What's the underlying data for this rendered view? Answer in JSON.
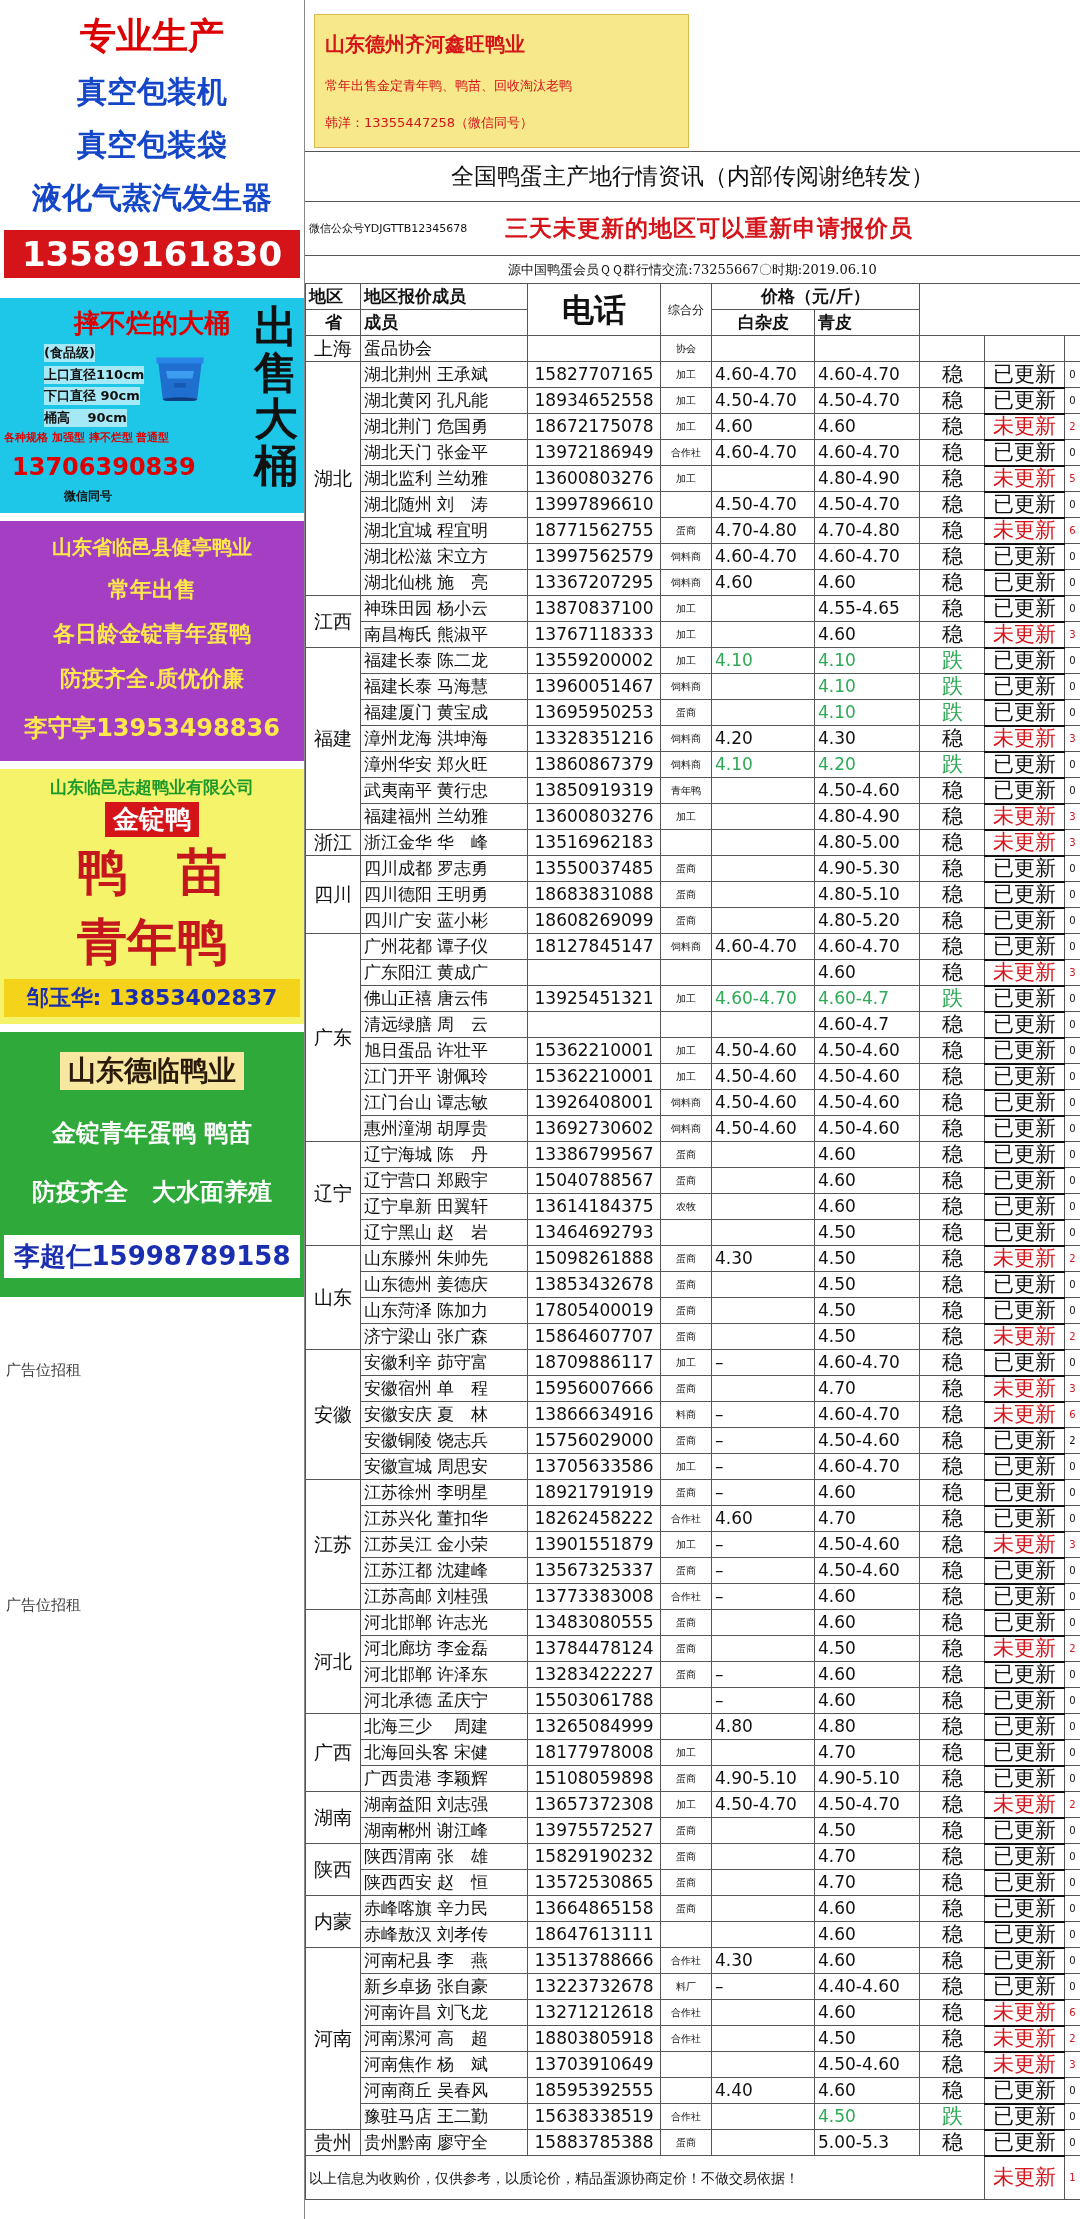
{
  "ads": [
    {
      "kind": "machine",
      "heading": "专业生产",
      "lines": [
        "真空包装机",
        "真空包装袋",
        "液化气蒸汽发生器"
      ],
      "phone": "13589161830"
    },
    {
      "kind": "bucket",
      "heading": "摔不烂的大桶",
      "lines": [
        "(食品级)",
        "上口直径110cm",
        "下口直径 90cm",
        "桶高　 90cm"
      ],
      "note": "各种规格 加强型 摔不烂型 普通型",
      "phone": "13706390839",
      "wechat": "微信同号",
      "side": "出售大桶"
    },
    {
      "kind": "purple",
      "heading": "山东省临邑县健亭鸭业",
      "lines": [
        "常年出售",
        "各日龄金锭青年蛋鸭",
        "防疫齐全.质优价廉"
      ],
      "phone": "李守亭13953498836"
    },
    {
      "kind": "yellow",
      "heading": "山东临邑志超鸭业有限公司",
      "badge": "金锭鸭",
      "lines": [
        "鸭　苗",
        "青年鸭"
      ],
      "phone": "邹玉华: 13853402837"
    },
    {
      "kind": "green",
      "heading": "山东德临鸭业",
      "lines": [
        "金锭青年蛋鸭 鸭苗",
        "防疫齐全　大水面养殖"
      ],
      "phone": "李超仁15998789158"
    }
  ],
  "vacancies": [
    "广告位招租",
    "广告位招租"
  ],
  "top_ad": {
    "heading": "山东德州齐河鑫旺鸭业",
    "lines": [
      "常年出售金定青年鸭、鸭苗、回收淘汰老鸭",
      "韩洋：13355447258（微信同号）"
    ]
  },
  "title": "全国鸭蛋主产地行情资讯（内部传阅谢绝转发）",
  "wechat": "微信公众号YDJGTTB12345678",
  "notice": "三天未更新的地区可以重新申请报价员",
  "source": "源中国鸭蛋会员ＱＱ群行情交流:73255667〇时期:2019.06.10",
  "header": {
    "region": "地区",
    "member_group": "地区报价成员",
    "phone": "电话",
    "score": "综合分",
    "price": "价格（元/斤）",
    "province": "省",
    "member": "成员",
    "white": "白杂皮",
    "green": "青皮"
  },
  "groups": [
    {
      "province": "上海",
      "rows": [
        {
          "member": "蛋品协会",
          "type": "协会"
        }
      ]
    },
    {
      "province": "湖北",
      "rows": [
        {
          "member": "湖北荆州 王承斌",
          "phone": "15827707165",
          "type": "加工",
          "white": "4.60-4.70",
          "green": "4.60-4.70",
          "trend": "稳",
          "down": false,
          "status": "已更新",
          "updated": true,
          "count": "0"
        },
        {
          "member": "湖北黄冈 孔凡能",
          "phone": "18934652558",
          "type": "加工",
          "white": "4.50-4.70",
          "green": "4.50-4.70",
          "trend": "稳",
          "down": false,
          "status": "已更新",
          "updated": true,
          "count": "0"
        },
        {
          "member": "湖北荆门 危国勇",
          "phone": "18672175078",
          "type": "加工",
          "white": "4.60",
          "green": "4.60",
          "trend": "稳",
          "down": false,
          "status": "未更新",
          "updated": false,
          "count": "2"
        },
        {
          "member": "湖北天门 张金平",
          "phone": "13972186949",
          "type": "合作社",
          "white": "4.60-4.70",
          "green": "4.60-4.70",
          "trend": "稳",
          "down": false,
          "status": "已更新",
          "updated": true,
          "count": "0"
        },
        {
          "member": "湖北监利 兰幼雅",
          "phone": "13600803276",
          "type": "加工",
          "green": "4.80-4.90",
          "trend": "稳",
          "down": false,
          "status": "未更新",
          "updated": false,
          "count": "5"
        },
        {
          "member": "湖北随州 刘　涛",
          "phone": "13997896610",
          "white": "4.50-4.70",
          "green": "4.50-4.70",
          "trend": "稳",
          "down": false,
          "status": "已更新",
          "updated": true,
          "count": "0"
        },
        {
          "member": "湖北宜城 程宜明",
          "phone": "18771562755",
          "type": "蛋商",
          "white": "4.70-4.80",
          "green": "4.70-4.80",
          "trend": "稳",
          "down": false,
          "status": "未更新",
          "updated": false,
          "count": "6"
        },
        {
          "member": "湖北松滋 宋立方",
          "phone": "13997562579",
          "type": "饲料商",
          "white": "4.60-4.70",
          "green": "4.60-4.70",
          "trend": "稳",
          "down": false,
          "status": "已更新",
          "updated": true,
          "count": "0"
        },
        {
          "member": "湖北仙桃 施　亮",
          "phone": "13367207295",
          "type": "饲料商",
          "white": "4.60",
          "green": "4.60",
          "trend": "稳",
          "down": false,
          "status": "已更新",
          "updated": true,
          "count": "0"
        }
      ]
    },
    {
      "province": "江西",
      "rows": [
        {
          "member": "神珠田园 杨小云",
          "phone": "13870837100",
          "type": "加工",
          "green": "4.55-4.65",
          "trend": "稳",
          "down": false,
          "status": "已更新",
          "updated": true,
          "count": "0"
        },
        {
          "member": "南昌梅氏 熊淑平",
          "phone": "13767118333",
          "type": "加工",
          "green": "4.60",
          "trend": "稳",
          "down": false,
          "status": "未更新",
          "updated": false,
          "count": "3"
        }
      ]
    },
    {
      "province": "福建",
      "rows": [
        {
          "member": "福建长泰 陈二龙",
          "phone": "13559200002",
          "type": "加工",
          "white": "4.10",
          "green": "4.10",
          "trend": "跌",
          "down": true,
          "status": "已更新",
          "updated": true,
          "count": "0"
        },
        {
          "member": "福建长泰 马海慧",
          "phone": "13960051467",
          "type": "饲料商",
          "green": "4.10",
          "trend": "跌",
          "down": true,
          "status": "已更新",
          "updated": true,
          "count": "0"
        },
        {
          "member": "福建厦门 黄宝成",
          "phone": "13695950253",
          "type": "蛋商",
          "green": "4.10",
          "trend": "跌",
          "down": true,
          "status": "已更新",
          "updated": true,
          "count": "0"
        },
        {
          "member": "漳州龙海 洪坤海",
          "phone": "13328351216",
          "type": "饲料商",
          "white": "4.20",
          "green": "4.30",
          "trend": "稳",
          "down": false,
          "status": "未更新",
          "updated": false,
          "count": "3"
        },
        {
          "member": "漳州华安 郑火旺",
          "phone": "13860867379",
          "type": "饲料商",
          "white": "4.10",
          "green": "4.20",
          "trend": "跌",
          "down": true,
          "status": "已更新",
          "updated": true,
          "count": "0"
        },
        {
          "member": "武夷南平 黄行忠",
          "phone": "13850919319",
          "type": "青年鸭",
          "green": "4.50-4.60",
          "trend": "稳",
          "down": false,
          "status": "已更新",
          "updated": true,
          "count": "0"
        },
        {
          "member": "福建福州 兰幼雅",
          "phone": "13600803276",
          "type": "加工",
          "green": "4.80-4.90",
          "trend": "稳",
          "down": false,
          "status": "未更新",
          "updated": false,
          "count": "3"
        }
      ]
    },
    {
      "province": "浙江",
      "rows": [
        {
          "member": "浙江金华 华　峰",
          "phone": "13516962183",
          "green": "4.80-5.00",
          "trend": "稳",
          "down": false,
          "status": "未更新",
          "updated": false,
          "count": "3"
        }
      ]
    },
    {
      "province": "四川",
      "rows": [
        {
          "member": "四川成都 罗志勇",
          "phone": "13550037485",
          "type": "蛋商",
          "green": "4.90-5.30",
          "trend": "稳",
          "down": false,
          "status": "已更新",
          "updated": true,
          "count": "0"
        },
        {
          "member": "四川德阳 王明勇",
          "phone": "18683831088",
          "type": "蛋商",
          "green": "4.80-5.10",
          "trend": "稳",
          "down": false,
          "status": "已更新",
          "updated": true,
          "count": "0"
        },
        {
          "member": "四川广安 蓝小彬",
          "phone": "18608269099",
          "type": "蛋商",
          "green": "4.80-5.20",
          "trend": "稳",
          "down": false,
          "status": "已更新",
          "updated": true,
          "count": "0"
        }
      ]
    },
    {
      "province": "广东",
      "rows": [
        {
          "member": "广州花都 谭子仪",
          "phone": "18127845147",
          "type": "饲料商",
          "white": "4.60-4.70",
          "green": "4.60-4.70",
          "trend": "稳",
          "down": false,
          "status": "已更新",
          "updated": true,
          "count": "0"
        },
        {
          "member": "广东阳江 黄成广",
          "green": "4.60",
          "trend": "稳",
          "down": false,
          "status": "未更新",
          "updated": false,
          "count": "3"
        },
        {
          "member": "佛山正禧 唐云伟",
          "phone": "13925451321",
          "type": "加工",
          "white": "4.60-4.70",
          "green": "4.60-4.7",
          "trend": "跌",
          "down": true,
          "status": "已更新",
          "updated": true,
          "count": "0"
        },
        {
          "member": "清远绿膳 周　云",
          "green": "4.60-4.7",
          "trend": "稳",
          "down": false,
          "status": "已更新",
          "updated": true,
          "count": "0"
        },
        {
          "member": "旭日蛋品 许壮平",
          "phone": "15362210001",
          "type": "加工",
          "white": "4.50-4.60",
          "green": "4.50-4.60",
          "trend": "稳",
          "down": false,
          "status": "已更新",
          "updated": true,
          "count": "0"
        },
        {
          "member": "江门开平 谢佩玲",
          "phone": "15362210001",
          "type": "加工",
          "white": "4.50-4.60",
          "green": "4.50-4.60",
          "trend": "稳",
          "down": false,
          "status": "已更新",
          "updated": true,
          "count": "0"
        },
        {
          "member": "江门台山 谭志敏",
          "phone": "13926408001",
          "type": "饲料商",
          "white": "4.50-4.60",
          "green": "4.50-4.60",
          "trend": "稳",
          "down": false,
          "status": "已更新",
          "updated": true,
          "count": "0"
        },
        {
          "member": "惠州潼湖 胡厚贵",
          "phone": "13692730602",
          "type": "饲料商",
          "white": "4.50-4.60",
          "green": "4.50-4.60",
          "trend": "稳",
          "down": false,
          "status": "已更新",
          "updated": true,
          "count": "0"
        }
      ]
    },
    {
      "province": "辽宁",
      "rows": [
        {
          "member": "辽宁海城 陈　丹",
          "phone": "13386799567",
          "type": "蛋商",
          "green": "4.60",
          "trend": "稳",
          "down": false,
          "status": "已更新",
          "updated": true,
          "count": "0"
        },
        {
          "member": "辽宁营口 郑殿宇",
          "phone": "15040788567",
          "type": "蛋商",
          "green": "4.60",
          "trend": "稳",
          "down": false,
          "status": "已更新",
          "updated": true,
          "count": "0"
        },
        {
          "member": "辽宁阜新 田翼轩",
          "phone": "13614184375",
          "type": "农牧",
          "green": "4.60",
          "trend": "稳",
          "down": false,
          "status": "已更新",
          "updated": true,
          "count": "0"
        },
        {
          "member": "辽宁黑山 赵　岩",
          "phone": "13464692793",
          "green": "4.50",
          "trend": "稳",
          "down": false,
          "status": "已更新",
          "updated": true,
          "count": "0"
        }
      ]
    },
    {
      "province": "山东",
      "rows": [
        {
          "member": "山东滕州 朱帅先",
          "phone": "15098261888",
          "type": "蛋商",
          "white": "4.30",
          "green": "4.50",
          "trend": "稳",
          "down": false,
          "status": "未更新",
          "updated": false,
          "count": "2"
        },
        {
          "member": "山东德州 姜德庆",
          "phone": "13853432678",
          "type": "蛋商",
          "green": "4.50",
          "trend": "稳",
          "down": false,
          "status": "已更新",
          "updated": true,
          "count": "0"
        },
        {
          "member": "山东菏泽 陈加力",
          "phone": "17805400019",
          "type": "蛋商",
          "green": "4.50",
          "trend": "稳",
          "down": false,
          "status": "已更新",
          "updated": true,
          "count": "0"
        },
        {
          "member": "济宁梁山 张广森",
          "phone": "15864607707",
          "type": "蛋商",
          "green": "4.50",
          "trend": "稳",
          "down": false,
          "status": "未更新",
          "updated": false,
          "count": "2"
        }
      ]
    },
    {
      "province": "安徽",
      "rows": [
        {
          "member": "安徽利辛 茆守富",
          "phone": "18709886117",
          "type": "加工",
          "white": "–",
          "green": "4.60-4.70",
          "trend": "稳",
          "down": false,
          "status": "已更新",
          "updated": true,
          "count": "0"
        },
        {
          "member": "安徽宿州 单　程",
          "phone": "15956007666",
          "type": "蛋商",
          "green": "4.70",
          "trend": "稳",
          "down": false,
          "status": "未更新",
          "updated": false,
          "count": "3"
        },
        {
          "member": "安徽安庆 夏　林",
          "phone": "13866634916",
          "type": "料商",
          "white": "–",
          "green": "4.60-4.70",
          "trend": "稳",
          "down": false,
          "status": "未更新",
          "updated": false,
          "count": "6"
        },
        {
          "member": "安徽铜陵 饶志兵",
          "phone": "15756029000",
          "type": "蛋商",
          "white": "–",
          "green": "4.50-4.60",
          "trend": "稳",
          "down": false,
          "status": "已更新",
          "updated": true,
          "count": "2"
        },
        {
          "member": "安徽宣城 周思安",
          "phone": "13705633586",
          "type": "加工",
          "white": "–",
          "green": "4.60-4.70",
          "trend": "稳",
          "down": false,
          "status": "已更新",
          "updated": true,
          "count": "0"
        }
      ]
    },
    {
      "province": "江苏",
      "rows": [
        {
          "member": "江苏徐州 李明星",
          "phone": "18921791919",
          "type": "蛋商",
          "white": "–",
          "green": "4.60",
          "trend": "稳",
          "down": false,
          "status": "已更新",
          "updated": true,
          "count": "0"
        },
        {
          "member": "江苏兴化 董扣华",
          "phone": "18262458222",
          "type": "合作社",
          "white": "4.60",
          "green": "4.70",
          "trend": "稳",
          "down": false,
          "status": "已更新",
          "updated": true,
          "count": "0"
        },
        {
          "member": "江苏吴江 金小荣",
          "phone": "13901551879",
          "type": "加工",
          "white": "–",
          "green": "4.50-4.60",
          "trend": "稳",
          "down": false,
          "status": "未更新",
          "updated": false,
          "count": "3"
        },
        {
          "member": "江苏江都 沈建峰",
          "phone": "13567325337",
          "type": "蛋商",
          "white": "–",
          "green": "4.50-4.60",
          "trend": "稳",
          "down": false,
          "status": "已更新",
          "updated": true,
          "count": "0"
        },
        {
          "member": "江苏高邮 刘桂强",
          "phone": "13773383008",
          "type": "合作社",
          "white": "–",
          "green": "4.60",
          "trend": "稳",
          "down": false,
          "status": "已更新",
          "updated": true,
          "count": "0"
        }
      ]
    },
    {
      "province": "河北",
      "rows": [
        {
          "member": "河北邯郸 许志光",
          "phone": "13483080555",
          "type": "蛋商",
          "green": "4.60",
          "trend": "稳",
          "down": false,
          "status": "已更新",
          "updated": true,
          "count": "0"
        },
        {
          "member": "河北廊坊 李金磊",
          "phone": "13784478124",
          "type": "蛋商",
          "green": "4.50",
          "trend": "稳",
          "down": false,
          "status": "未更新",
          "updated": false,
          "count": "2"
        },
        {
          "member": "河北邯郸 许泽东",
          "phone": "13283422227",
          "type": "蛋商",
          "white": "–",
          "green": "4.60",
          "trend": "稳",
          "down": false,
          "status": "已更新",
          "updated": true,
          "count": "0"
        },
        {
          "member": "河北承德 孟庆宁",
          "phone": "15503061788",
          "white": "–",
          "green": "4.60",
          "trend": "稳",
          "down": false,
          "status": "已更新",
          "updated": true,
          "count": "0"
        }
      ]
    },
    {
      "province": "广西",
      "rows": [
        {
          "member": "北海三少　 周建",
          "phone": "13265084999",
          "white": "4.80",
          "green": "4.80",
          "trend": "稳",
          "down": false,
          "status": "已更新",
          "updated": true,
          "count": "0"
        },
        {
          "member": "北海回头客 宋健",
          "phone": "18177978008",
          "type": "加工",
          "green": "4.70",
          "trend": "稳",
          "down": false,
          "status": "已更新",
          "updated": true,
          "count": "0"
        },
        {
          "member": "广西贵港 李颖辉",
          "phone": "15108059898",
          "type": "蛋商",
          "white": "4.90-5.10",
          "green": "4.90-5.10",
          "trend": "稳",
          "down": false,
          "status": "已更新",
          "updated": true,
          "count": "0"
        }
      ]
    },
    {
      "province": "湖南",
      "rows": [
        {
          "member": "湖南益阳 刘志强",
          "phone": "13657372308",
          "type": "加工",
          "white": "4.50-4.70",
          "green": "4.50-4.70",
          "trend": "稳",
          "down": false,
          "status": "未更新",
          "updated": false,
          "count": "2"
        },
        {
          "member": "湖南郴州 谢江峰",
          "phone": "13975572527",
          "type": "蛋商",
          "green": "4.50",
          "trend": "稳",
          "down": false,
          "status": "已更新",
          "updated": true,
          "count": "0"
        }
      ]
    },
    {
      "province": "陕西",
      "rows": [
        {
          "member": "陕西渭南 张　雄",
          "phone": "15829190232",
          "type": "蛋商",
          "green": "4.70",
          "trend": "稳",
          "down": false,
          "status": "已更新",
          "updated": true,
          "count": "0"
        },
        {
          "member": "陕西西安 赵　恒",
          "phone": "13572530865",
          "type": "蛋商",
          "green": "4.70",
          "trend": "稳",
          "down": false,
          "status": "已更新",
          "updated": true,
          "count": "0"
        }
      ]
    },
    {
      "province": "内蒙",
      "rows": [
        {
          "member": "赤峰喀旗 辛力民",
          "phone": "13664865158",
          "type": "蛋商",
          "green": "4.60",
          "trend": "稳",
          "down": false,
          "status": "已更新",
          "updated": true,
          "count": "0"
        },
        {
          "member": "赤峰敖汉 刘孝传",
          "phone": "18647613111",
          "green": "4.60",
          "trend": "稳",
          "down": false,
          "status": "已更新",
          "updated": true,
          "count": "0"
        }
      ]
    },
    {
      "province": "河南",
      "rows": [
        {
          "member": "河南杞县 李　燕",
          "phone": "13513788666",
          "type": "合作社",
          "white": "4.30",
          "green": "4.60",
          "trend": "稳",
          "down": false,
          "status": "已更新",
          "updated": true,
          "count": "0"
        },
        {
          "member": "新乡卓扬 张自豪",
          "phone": "13223732678",
          "type": "料厂",
          "white": "–",
          "green": "4.40-4.60",
          "trend": "稳",
          "down": false,
          "status": "已更新",
          "updated": true,
          "count": "0"
        },
        {
          "member": "河南许昌 刘飞龙",
          "phone": "13271212618",
          "type": "合作社",
          "green": "4.60",
          "trend": "稳",
          "down": false,
          "status": "未更新",
          "updated": false,
          "count": "6"
        },
        {
          "member": "河南漯河 高　超",
          "phone": "18803805918",
          "type": "合作社",
          "green": "4.50",
          "trend": "稳",
          "down": false,
          "status": "未更新",
          "updated": false,
          "count": "2"
        },
        {
          "member": "河南焦作 杨　斌",
          "phone": "13703910649",
          "green": "4.50-4.60",
          "trend": "稳",
          "down": false,
          "status": "未更新",
          "updated": false,
          "count": "3"
        },
        {
          "member": "河南商丘 吴春风",
          "phone": "18595392555",
          "white": "4.40",
          "green": "4.60",
          "trend": "稳",
          "down": false,
          "status": "已更新",
          "updated": true,
          "count": "0"
        },
        {
          "member": "豫驻马店 王二勤",
          "phone": "15638338519",
          "type": "合作社",
          "green": "4.50",
          "trend": "跌",
          "down": true,
          "status": "已更新",
          "updated": true,
          "count": "0"
        }
      ]
    },
    {
      "province": "贵州",
      "rows": [
        {
          "member": "贵州黔南 廖守全",
          "phone": "15883785388",
          "type": "蛋商",
          "green": "5.00-5.3",
          "trend": "稳",
          "down": false,
          "status": "已更新",
          "updated": true,
          "count": "0"
        }
      ]
    }
  ],
  "footer": {
    "text": "以上信息为收购价，仅供参考，以质论价，精品蛋源协商定价！不做交易依据！",
    "status": "未更新",
    "updated": false,
    "count": "1"
  }
}
